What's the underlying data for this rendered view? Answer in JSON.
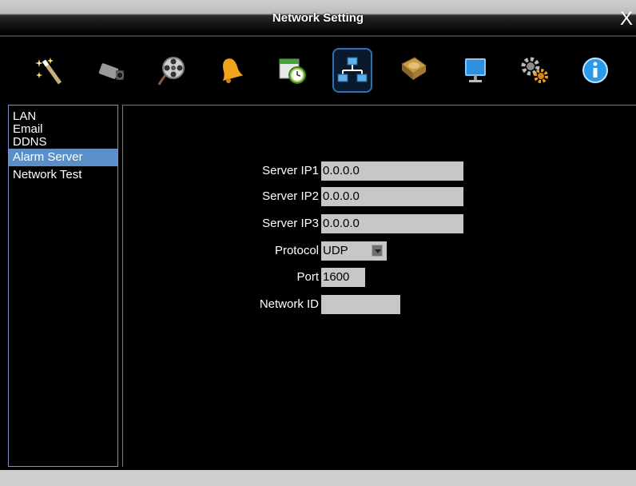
{
  "window": {
    "title": "Network Setting",
    "close_glyph": "X"
  },
  "toolbar": {
    "icons": [
      "wand-icon",
      "camera-icon",
      "film-reel-icon",
      "bell-icon",
      "schedule-clock-icon",
      "network-icon",
      "hard-disk-icon",
      "monitor-icon",
      "gears-icon",
      "info-icon"
    ],
    "active_index": 5
  },
  "sidebar": {
    "items": [
      {
        "label": "LAN"
      },
      {
        "label": "Email"
      },
      {
        "label": "DDNS"
      },
      {
        "label": "Alarm Server"
      },
      {
        "label": "Network Test"
      }
    ],
    "selected": "Alarm Server"
  },
  "form": {
    "server_ip1": {
      "label": "Server IP1",
      "value": "0.0.0.0"
    },
    "server_ip2": {
      "label": "Server IP2",
      "value": "0.0.0.0"
    },
    "server_ip3": {
      "label": "Server IP3",
      "value": "0.0.0.0"
    },
    "protocol": {
      "label": "Protocol",
      "value": "UDP"
    },
    "port": {
      "label": "Port",
      "value": "1600"
    },
    "network_id": {
      "label": "Network ID",
      "value": ""
    }
  },
  "colors": {
    "selected_item_bg": "#5a8fc7",
    "field_bg": "#c7c7c7",
    "active_tool_border": "#2e6fb5"
  }
}
